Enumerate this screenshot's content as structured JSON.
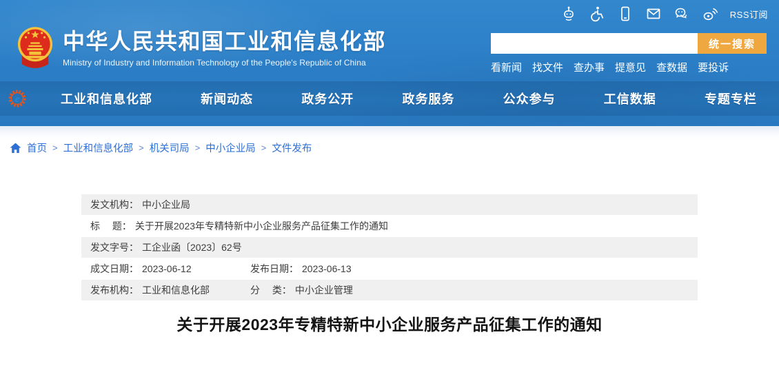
{
  "topbar": {
    "rss_label": "RSS订阅",
    "icons": [
      "robot-icon",
      "accessibility-icon",
      "mobile-icon",
      "email-icon",
      "wechat-icon",
      "weibo-icon"
    ]
  },
  "brand": {
    "title_zh": "中华人民共和国工业和信息化部",
    "title_en": "Ministry of Industry and Information Technology of the People's Republic of China"
  },
  "search": {
    "value": "",
    "button_label": "统一搜索"
  },
  "quick_links": [
    "看新闻",
    "找文件",
    "查办事",
    "提意见",
    "查数据",
    "要投诉"
  ],
  "nav": {
    "items": [
      "工业和信息化部",
      "新闻动态",
      "政务公开",
      "政务服务",
      "公众参与",
      "工信数据",
      "专题专栏"
    ]
  },
  "breadcrumb": {
    "separator": ">",
    "items": [
      "首页",
      "工业和信息化部",
      "机关司局",
      "中小企业局",
      "文件发布"
    ]
  },
  "meta": {
    "rows": [
      {
        "cells": [
          {
            "label": "发文机构：",
            "value": "中小企业局"
          }
        ]
      },
      {
        "cells": [
          {
            "label": "标　 题：",
            "value": "关于开展2023年专精特新中小企业服务产品征集工作的通知"
          }
        ]
      },
      {
        "cells": [
          {
            "label": "发文字号：",
            "value": "工企业函〔2023〕62号"
          }
        ]
      },
      {
        "cells": [
          {
            "label": "成文日期：",
            "value": "2023-06-12"
          },
          {
            "label": "发布日期：",
            "value": "2023-06-13"
          }
        ]
      },
      {
        "cells": [
          {
            "label": "发布机构：",
            "value": "工业和信息化部"
          },
          {
            "label": "分　 类：",
            "value": "中小企业管理"
          }
        ]
      }
    ]
  },
  "article": {
    "title": "关于开展2023年专精特新中小企业服务产品征集工作的通知"
  },
  "colors": {
    "header_blue": "#2b7ec6",
    "nav_band_blue": "#2372b5",
    "accent_orange": "#efa740",
    "link_blue": "#2e6fd3",
    "row_gray": "#f0f0f0",
    "emblem_red": "#dd2b1c",
    "emblem_gold": "#f5c33b"
  }
}
